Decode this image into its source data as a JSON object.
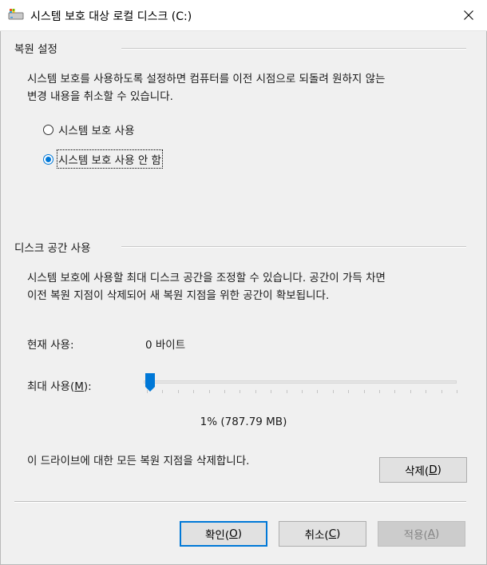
{
  "window": {
    "title": "시스템 보호 대상 로컬 디스크 (C:)"
  },
  "restore_settings": {
    "heading": "복원 설정",
    "description_line1": "시스템 보호를 사용하도록 설정하면 컴퓨터를 이전 시점으로 되돌려 원하지 않는",
    "description_line2": "변경 내용을 취소할 수 있습니다.",
    "options": [
      {
        "label": "시스템 보호 사용",
        "checked": false
      },
      {
        "label": "시스템 보호 사용 안 함",
        "checked": true
      }
    ]
  },
  "disk_usage": {
    "heading": "디스크 공간 사용",
    "description_line1": "시스템 보호에 사용할 최대 디스크 공간을 조정할 수 있습니다. 공간이 가득 차면",
    "description_line2": "이전 복원 지점이 삭제되어 새 복원 지점을 위한 공간이 확보됩니다.",
    "current_label": "현재 사용:",
    "current_value": "0 바이트",
    "max_label_prefix": "최대 사용(",
    "max_label_key": "M",
    "max_label_suffix": "):",
    "slider_percent": 1,
    "percent_text": "1% (787.79 MB)",
    "delete_text": "이 드라이브에 대한 모든 복원 지점을 삭제합니다.",
    "delete_button": {
      "prefix": "삭제(",
      "key": "D",
      "suffix": ")"
    }
  },
  "buttons": {
    "ok": {
      "prefix": "확인(",
      "key": "O",
      "suffix": ")"
    },
    "cancel": {
      "prefix": "취소(",
      "key": "C",
      "suffix": ")"
    },
    "apply": {
      "prefix": "적용(",
      "key": "A",
      "suffix": ")"
    }
  },
  "colors": {
    "accent": "#0078d7",
    "window_bg": "#f0f0f0"
  }
}
